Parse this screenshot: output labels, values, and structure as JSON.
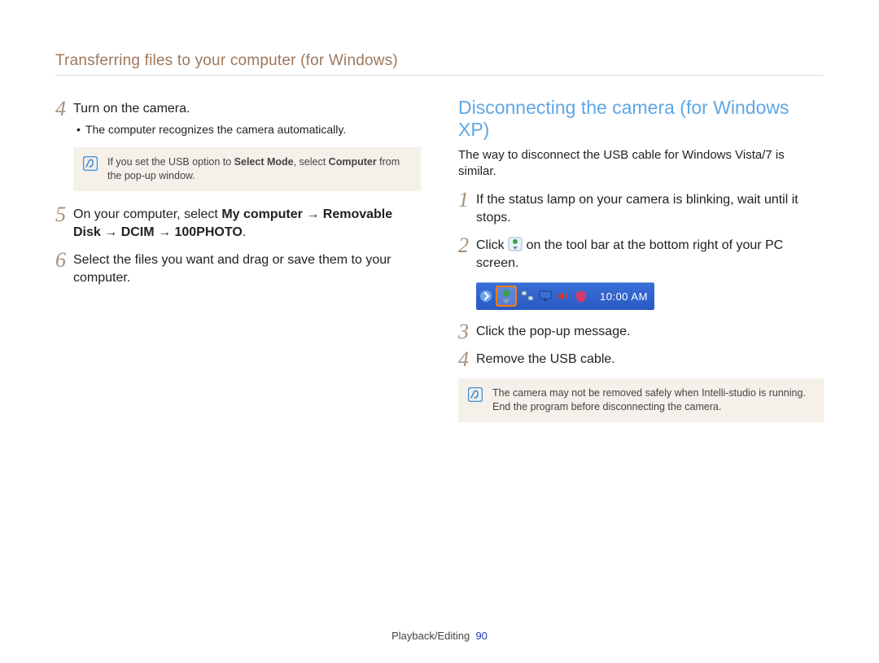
{
  "header": {
    "title": "Transferring files to your computer (for Windows)"
  },
  "left": {
    "step4": {
      "num": "4",
      "text": "Turn on the camera.",
      "bullet": "The computer recognizes the camera automatically."
    },
    "note1": {
      "pre": "If you set the USB option to ",
      "bold1": "Select Mode",
      "mid": ", select ",
      "bold2": "Computer",
      "post": " from the pop-up window."
    },
    "step5": {
      "num": "5",
      "pre": "On your computer, select ",
      "bold1": "My computer",
      "arrow": " → ",
      "bold2": "Removable Disk",
      "bold3": "DCIM",
      "bold4": "100PHOTO",
      "post": "."
    },
    "step6": {
      "num": "6",
      "text": "Select the files you want and drag or save them to your computer."
    }
  },
  "right": {
    "heading": "Disconnecting the camera (for Windows XP)",
    "sub": "The way to disconnect the USB cable for Windows Vista/7 is similar.",
    "step1": {
      "num": "1",
      "text": "If the status lamp on your camera is blinking, wait until it stops."
    },
    "step2": {
      "num": "2",
      "pre": "Click ",
      "post": " on the tool bar at the bottom right of your PC screen."
    },
    "taskbar": {
      "clock": "10:00 AM",
      "icons": {
        "remove": "safely-remove-hw-icon",
        "net": "network-icon",
        "vol": "volume-icon",
        "av": "antivirus-icon",
        "disp": "display-icon"
      }
    },
    "step3": {
      "num": "3",
      "text": "Click the pop-up message."
    },
    "step4": {
      "num": "4",
      "text": "Remove the USB cable."
    },
    "note2": {
      "text": "The camera may not be removed safely when Intelli-studio is running. End the program before disconnecting the camera."
    }
  },
  "footer": {
    "section": "Playback/Editing",
    "page": "90"
  }
}
